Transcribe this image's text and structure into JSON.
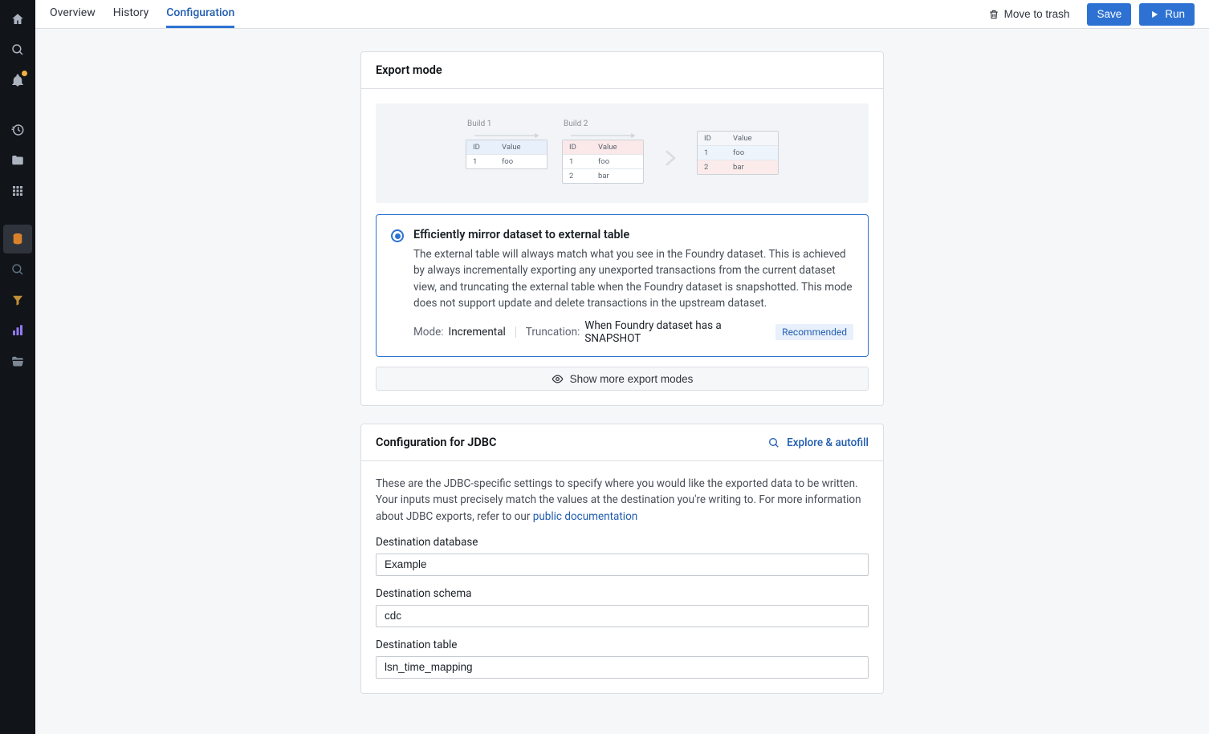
{
  "tabs": {
    "overview": "Overview",
    "history": "History",
    "configuration": "Configuration"
  },
  "topbar": {
    "trash": "Move to trash",
    "save": "Save",
    "run": "Run"
  },
  "export_mode": {
    "card_title": "Export mode",
    "diagram": {
      "build1": "Build 1",
      "build2": "Build 2",
      "col_id": "ID",
      "col_value": "Value",
      "rows1": [
        [
          "1",
          "foo"
        ]
      ],
      "rows2": [
        [
          "1",
          "foo"
        ],
        [
          "2",
          "bar"
        ]
      ],
      "rows3": [
        [
          "1",
          "foo"
        ],
        [
          "2",
          "bar"
        ]
      ]
    },
    "option": {
      "title": "Efficiently mirror dataset to external table",
      "desc": "The external table will always match what you see in the Foundry dataset. This is achieved by always incrementally exporting any unexported transactions from the current dataset view, and truncating the external table when the Foundry dataset is snapshotted. This mode does not support update and delete transactions in the upstream dataset.",
      "mode_label": "Mode:",
      "mode_value": "Incremental",
      "trunc_label": "Truncation:",
      "trunc_value": "When Foundry dataset has a SNAPSHOT",
      "badge": "Recommended"
    },
    "show_more": "Show more export modes"
  },
  "jdbc": {
    "card_title": "Configuration for JDBC",
    "explore": "Explore & autofill",
    "help_pre": "These are the JDBC-specific settings to specify where you would like the exported data to be written. Your inputs must precisely match the values at the destination you're writing to. For more information about JDBC exports, refer to our ",
    "help_link": "public documentation",
    "fields": {
      "db_label": "Destination database",
      "db_value": "Example",
      "schema_label": "Destination schema",
      "schema_value": "cdc",
      "table_label": "Destination table",
      "table_value": "lsn_time_mapping"
    }
  }
}
